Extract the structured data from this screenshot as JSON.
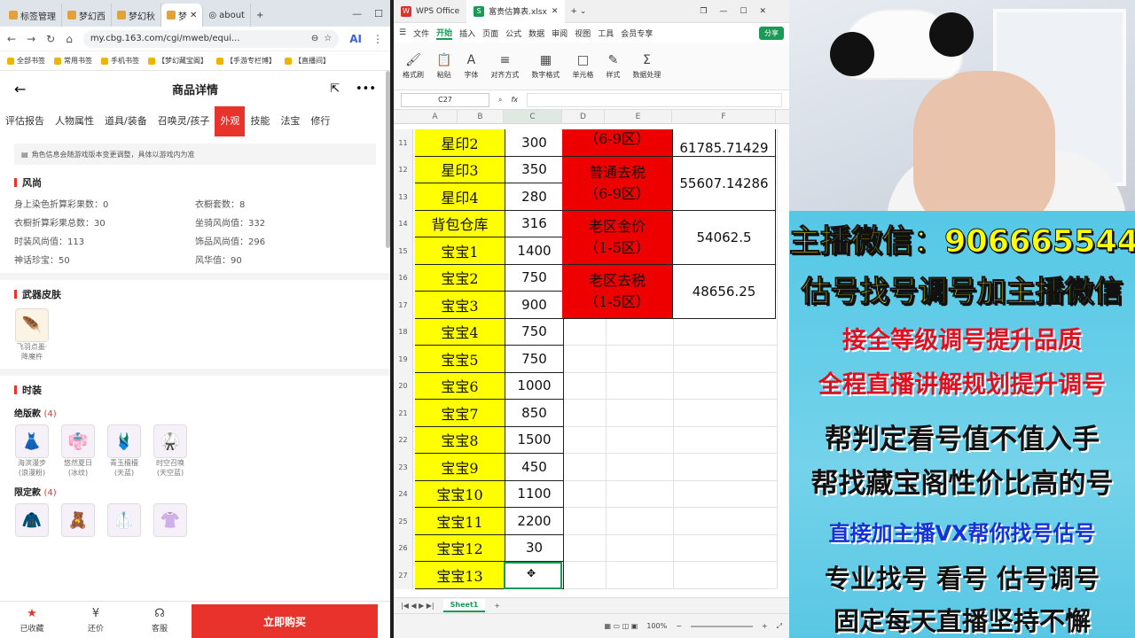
{
  "browser": {
    "tabs": [
      "标签管理",
      "梦幻西",
      "梦幻秋",
      "梦",
      "about"
    ],
    "url": "my.cbg.163.com/cgi/mweb/equi...",
    "ai_label": "AI",
    "bookmarks": [
      "全部书签",
      "常用书签",
      "手机书签",
      "【梦幻藏宝阁】",
      "【手游专栏博】",
      "【直播间】"
    ]
  },
  "cbg": {
    "title": "商品详情",
    "tabs": [
      "评估报告",
      "人物属性",
      "道具/装备",
      "召唤灵/孩子",
      "外观",
      "技能",
      "法宝",
      "修行"
    ],
    "active_tab": "外观",
    "notice": "角色信息会随游戏版本变更调整，具体以游戏内为准",
    "fashion": {
      "heading": "风尚",
      "stats": [
        "身上染色折算彩果数：0",
        "衣橱套数：8",
        "衣橱折算彩果总数：30",
        "坐骑风尚值：332",
        "时装风尚值：113",
        "饰品风尚值：296",
        "神话珍宝：50",
        "风华值：90"
      ]
    },
    "weapon_skin": {
      "heading": "武器皮肤",
      "items": [
        {
          "name": "飞羽点墨·降魔杵",
          "icon": "🪶"
        }
      ]
    },
    "costume": {
      "heading": "时装",
      "limited_out": {
        "label": "绝版款",
        "count": "(4)",
        "items": [
          {
            "name": "海滨漫步(浪漫粉)",
            "icon": "👗"
          },
          {
            "name": "悠然夏日(冰纹)",
            "icon": "👘"
          },
          {
            "name": "青玉檀檀(天蓝)",
            "icon": "🩱"
          },
          {
            "name": "时空召唤(天空蓝)",
            "icon": "🥋"
          }
        ]
      },
      "limited": {
        "label": "限定款",
        "count": "(4)",
        "items": [
          {
            "icon": "🧥"
          },
          {
            "icon": "🧸"
          },
          {
            "icon": "🥼"
          },
          {
            "icon": "👚"
          }
        ]
      }
    },
    "bottom": {
      "fav": "已收藏",
      "bargain": "还价",
      "service": "客服",
      "buy": "立即购买"
    }
  },
  "wps": {
    "app_tab": "WPS Office",
    "file_tab": "富贵估算表.xlsx",
    "menu": [
      "文件",
      "开始",
      "插入",
      "页面",
      "公式",
      "数据",
      "审阅",
      "视图",
      "工具",
      "会员专享"
    ],
    "share": "分享",
    "ribbon": [
      "格式刷",
      "粘贴",
      "字体",
      "对齐方式",
      "数字格式",
      "单元格",
      "样式",
      "数据处理"
    ],
    "cell_ref": "C27",
    "fx": "fx",
    "columns": [
      "A",
      "B",
      "C",
      "D",
      "E",
      "F"
    ],
    "rows": [
      {
        "n": "11",
        "a": "星印2",
        "c": "300"
      },
      {
        "n": "12",
        "a": "星印3",
        "c": "350"
      },
      {
        "n": "13",
        "a": "星印4",
        "c": "280"
      },
      {
        "n": "14",
        "a": "背包仓库",
        "c": "316"
      },
      {
        "n": "15",
        "a": "宝宝1",
        "c": "1400"
      },
      {
        "n": "16",
        "a": "宝宝2",
        "c": "750"
      },
      {
        "n": "17",
        "a": "宝宝3",
        "c": "900"
      },
      {
        "n": "18",
        "a": "宝宝4",
        "c": "750"
      },
      {
        "n": "19",
        "a": "宝宝5",
        "c": "750"
      },
      {
        "n": "20",
        "a": "宝宝6",
        "c": "1000"
      },
      {
        "n": "21",
        "a": "宝宝7",
        "c": "850"
      },
      {
        "n": "22",
        "a": "宝宝8",
        "c": "1500"
      },
      {
        "n": "23",
        "a": "宝宝9",
        "c": "450"
      },
      {
        "n": "24",
        "a": "宝宝10",
        "c": "1100"
      },
      {
        "n": "25",
        "a": "宝宝11",
        "c": "2200"
      },
      {
        "n": "26",
        "a": "宝宝12",
        "c": "30"
      },
      {
        "n": "27",
        "a": "宝宝13",
        "c": ""
      }
    ],
    "red_blocks": [
      {
        "line1": "（6-9区）",
        "line2": ""
      },
      {
        "line1": "普通去税",
        "line2": "（6-9区）"
      },
      {
        "line1": "老区金价",
        "line2": "（1-5区）"
      },
      {
        "line1": "老区去税",
        "line2": "（1-5区）"
      }
    ],
    "f_values": [
      "61785.71429",
      "55607.14286",
      "54062.5",
      "48656.25"
    ],
    "sheet_tab": "Sheet1",
    "zoom": "100%"
  },
  "stream": {
    "lines": [
      "主播微信：906665544",
      "估号找号调号加主播微信",
      "接全等级调号提升品质",
      "全程直播讲解规划提升调号",
      "帮判定看号值不值入手",
      "帮找藏宝阁性价比高的号",
      "直接加主播VX帮你找号估号",
      "专业找号  看号  估号调号",
      "固定每天直播坚持不懈"
    ]
  }
}
